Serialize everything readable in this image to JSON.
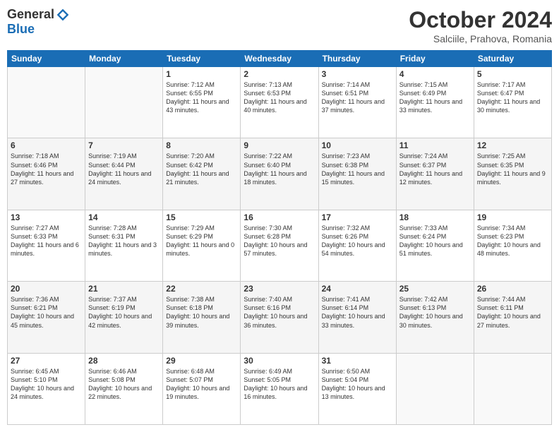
{
  "logo": {
    "general": "General",
    "blue": "Blue"
  },
  "header": {
    "month": "October 2024",
    "location": "Salciile, Prahova, Romania"
  },
  "weekdays": [
    "Sunday",
    "Monday",
    "Tuesday",
    "Wednesday",
    "Thursday",
    "Friday",
    "Saturday"
  ],
  "weeks": [
    [
      {
        "day": "",
        "info": ""
      },
      {
        "day": "",
        "info": ""
      },
      {
        "day": "1",
        "info": "Sunrise: 7:12 AM\nSunset: 6:55 PM\nDaylight: 11 hours and 43 minutes."
      },
      {
        "day": "2",
        "info": "Sunrise: 7:13 AM\nSunset: 6:53 PM\nDaylight: 11 hours and 40 minutes."
      },
      {
        "day": "3",
        "info": "Sunrise: 7:14 AM\nSunset: 6:51 PM\nDaylight: 11 hours and 37 minutes."
      },
      {
        "day": "4",
        "info": "Sunrise: 7:15 AM\nSunset: 6:49 PM\nDaylight: 11 hours and 33 minutes."
      },
      {
        "day": "5",
        "info": "Sunrise: 7:17 AM\nSunset: 6:47 PM\nDaylight: 11 hours and 30 minutes."
      }
    ],
    [
      {
        "day": "6",
        "info": "Sunrise: 7:18 AM\nSunset: 6:46 PM\nDaylight: 11 hours and 27 minutes."
      },
      {
        "day": "7",
        "info": "Sunrise: 7:19 AM\nSunset: 6:44 PM\nDaylight: 11 hours and 24 minutes."
      },
      {
        "day": "8",
        "info": "Sunrise: 7:20 AM\nSunset: 6:42 PM\nDaylight: 11 hours and 21 minutes."
      },
      {
        "day": "9",
        "info": "Sunrise: 7:22 AM\nSunset: 6:40 PM\nDaylight: 11 hours and 18 minutes."
      },
      {
        "day": "10",
        "info": "Sunrise: 7:23 AM\nSunset: 6:38 PM\nDaylight: 11 hours and 15 minutes."
      },
      {
        "day": "11",
        "info": "Sunrise: 7:24 AM\nSunset: 6:37 PM\nDaylight: 11 hours and 12 minutes."
      },
      {
        "day": "12",
        "info": "Sunrise: 7:25 AM\nSunset: 6:35 PM\nDaylight: 11 hours and 9 minutes."
      }
    ],
    [
      {
        "day": "13",
        "info": "Sunrise: 7:27 AM\nSunset: 6:33 PM\nDaylight: 11 hours and 6 minutes."
      },
      {
        "day": "14",
        "info": "Sunrise: 7:28 AM\nSunset: 6:31 PM\nDaylight: 11 hours and 3 minutes."
      },
      {
        "day": "15",
        "info": "Sunrise: 7:29 AM\nSunset: 6:29 PM\nDaylight: 11 hours and 0 minutes."
      },
      {
        "day": "16",
        "info": "Sunrise: 7:30 AM\nSunset: 6:28 PM\nDaylight: 10 hours and 57 minutes."
      },
      {
        "day": "17",
        "info": "Sunrise: 7:32 AM\nSunset: 6:26 PM\nDaylight: 10 hours and 54 minutes."
      },
      {
        "day": "18",
        "info": "Sunrise: 7:33 AM\nSunset: 6:24 PM\nDaylight: 10 hours and 51 minutes."
      },
      {
        "day": "19",
        "info": "Sunrise: 7:34 AM\nSunset: 6:23 PM\nDaylight: 10 hours and 48 minutes."
      }
    ],
    [
      {
        "day": "20",
        "info": "Sunrise: 7:36 AM\nSunset: 6:21 PM\nDaylight: 10 hours and 45 minutes."
      },
      {
        "day": "21",
        "info": "Sunrise: 7:37 AM\nSunset: 6:19 PM\nDaylight: 10 hours and 42 minutes."
      },
      {
        "day": "22",
        "info": "Sunrise: 7:38 AM\nSunset: 6:18 PM\nDaylight: 10 hours and 39 minutes."
      },
      {
        "day": "23",
        "info": "Sunrise: 7:40 AM\nSunset: 6:16 PM\nDaylight: 10 hours and 36 minutes."
      },
      {
        "day": "24",
        "info": "Sunrise: 7:41 AM\nSunset: 6:14 PM\nDaylight: 10 hours and 33 minutes."
      },
      {
        "day": "25",
        "info": "Sunrise: 7:42 AM\nSunset: 6:13 PM\nDaylight: 10 hours and 30 minutes."
      },
      {
        "day": "26",
        "info": "Sunrise: 7:44 AM\nSunset: 6:11 PM\nDaylight: 10 hours and 27 minutes."
      }
    ],
    [
      {
        "day": "27",
        "info": "Sunrise: 6:45 AM\nSunset: 5:10 PM\nDaylight: 10 hours and 24 minutes."
      },
      {
        "day": "28",
        "info": "Sunrise: 6:46 AM\nSunset: 5:08 PM\nDaylight: 10 hours and 22 minutes."
      },
      {
        "day": "29",
        "info": "Sunrise: 6:48 AM\nSunset: 5:07 PM\nDaylight: 10 hours and 19 minutes."
      },
      {
        "day": "30",
        "info": "Sunrise: 6:49 AM\nSunset: 5:05 PM\nDaylight: 10 hours and 16 minutes."
      },
      {
        "day": "31",
        "info": "Sunrise: 6:50 AM\nSunset: 5:04 PM\nDaylight: 10 hours and 13 minutes."
      },
      {
        "day": "",
        "info": ""
      },
      {
        "day": "",
        "info": ""
      }
    ]
  ]
}
